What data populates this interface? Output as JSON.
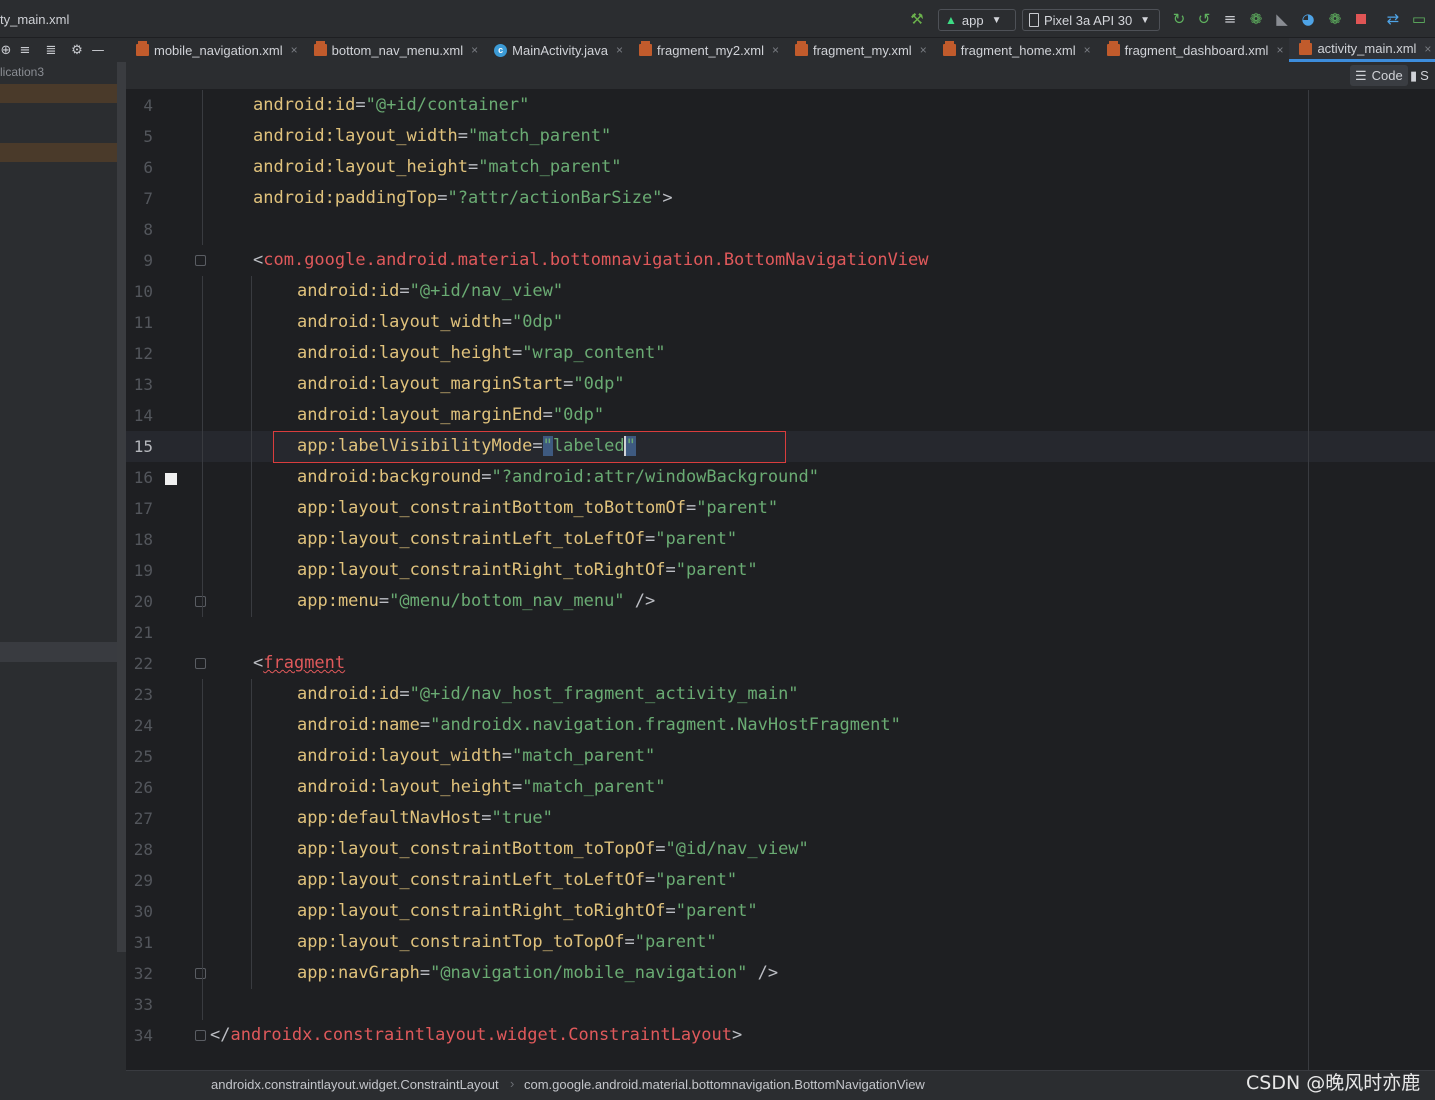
{
  "window": {
    "title": "ty_main.xml"
  },
  "toolbar": {
    "run_config": "app",
    "device": "Pixel 3a API 30",
    "icons": [
      "build-hammer-icon",
      "android-icon",
      "device-icon",
      "rerun-icon",
      "apply-changes-icon",
      "apply-code-changes-icon",
      "debug-icon",
      "attach-debugger-icon",
      "profile-icon",
      "coverage-icon",
      "stop-icon",
      "sync-gradle-icon",
      "device-manager-icon"
    ]
  },
  "left_panel": {
    "project_label": "lication3",
    "tools": [
      "target-icon",
      "expand-all-icon",
      "collapse-all-icon",
      "gear-icon",
      "minimize-icon"
    ]
  },
  "tabs": [
    {
      "label": "mobile_navigation.xml",
      "type": "xml",
      "active": false
    },
    {
      "label": "bottom_nav_menu.xml",
      "type": "xml",
      "active": false
    },
    {
      "label": "MainActivity.java",
      "type": "java",
      "active": false
    },
    {
      "label": "fragment_my2.xml",
      "type": "xml",
      "active": false
    },
    {
      "label": "fragment_my.xml",
      "type": "xml",
      "active": false
    },
    {
      "label": "fragment_home.xml",
      "type": "xml",
      "active": false
    },
    {
      "label": "fragment_dashboard.xml",
      "type": "xml",
      "active": false
    },
    {
      "label": "activity_main.xml",
      "type": "xml",
      "active": true
    }
  ],
  "view_mode": {
    "code_label": "Code",
    "split_label": "S"
  },
  "editor": {
    "current_line": "15",
    "lines": [
      {
        "n": "4",
        "indent": 1,
        "tokens": [
          [
            "attr",
            "android:id"
          ],
          [
            "punc",
            "="
          ],
          [
            "val",
            "\"@+id/container\""
          ]
        ]
      },
      {
        "n": "5",
        "indent": 1,
        "tokens": [
          [
            "attr",
            "android:layout_width"
          ],
          [
            "punc",
            "="
          ],
          [
            "val",
            "\"match_parent\""
          ]
        ]
      },
      {
        "n": "6",
        "indent": 1,
        "tokens": [
          [
            "attr",
            "android:layout_height"
          ],
          [
            "punc",
            "="
          ],
          [
            "val",
            "\"match_parent\""
          ]
        ]
      },
      {
        "n": "7",
        "indent": 1,
        "tokens": [
          [
            "attr",
            "android:paddingTop"
          ],
          [
            "punc",
            "="
          ],
          [
            "val",
            "\"?attr/actionBarSize\""
          ],
          [
            "punc",
            ">"
          ]
        ]
      },
      {
        "n": "8",
        "indent": 0,
        "tokens": []
      },
      {
        "n": "9",
        "indent": 1,
        "tokens": [
          [
            "punc",
            "<"
          ],
          [
            "tag",
            "com.google.android.material.bottomnavigation.BottomNavigationView"
          ]
        ]
      },
      {
        "n": "10",
        "indent": 2,
        "tokens": [
          [
            "attr",
            "android:id"
          ],
          [
            "punc",
            "="
          ],
          [
            "val",
            "\"@+id/nav_view\""
          ]
        ]
      },
      {
        "n": "11",
        "indent": 2,
        "tokens": [
          [
            "attr",
            "android:layout_width"
          ],
          [
            "punc",
            "="
          ],
          [
            "val",
            "\"0dp\""
          ]
        ]
      },
      {
        "n": "12",
        "indent": 2,
        "tokens": [
          [
            "attr",
            "android:layout_height"
          ],
          [
            "punc",
            "="
          ],
          [
            "val",
            "\"wrap_content\""
          ]
        ]
      },
      {
        "n": "13",
        "indent": 2,
        "tokens": [
          [
            "attr",
            "android:layout_marginStart"
          ],
          [
            "punc",
            "="
          ],
          [
            "val",
            "\"0dp\""
          ]
        ]
      },
      {
        "n": "14",
        "indent": 2,
        "tokens": [
          [
            "attr",
            "android:layout_marginEnd"
          ],
          [
            "punc",
            "="
          ],
          [
            "val",
            "\"0dp\""
          ]
        ]
      },
      {
        "n": "15",
        "indent": 2,
        "tokens": [
          [
            "attr",
            "app:labelVisibilityMode"
          ],
          [
            "punc",
            "="
          ],
          [
            "sel",
            "\""
          ],
          [
            "val",
            "labeled"
          ],
          [
            "selcaret",
            "\""
          ]
        ]
      },
      {
        "n": "16",
        "indent": 2,
        "tokens": [
          [
            "attr",
            "android:background"
          ],
          [
            "punc",
            "="
          ],
          [
            "val",
            "\"?android:attr/windowBackground\""
          ]
        ]
      },
      {
        "n": "17",
        "indent": 2,
        "tokens": [
          [
            "attr",
            "app:layout_constraintBottom_toBottomOf"
          ],
          [
            "punc",
            "="
          ],
          [
            "val",
            "\"parent\""
          ]
        ]
      },
      {
        "n": "18",
        "indent": 2,
        "tokens": [
          [
            "attr",
            "app:layout_constraintLeft_toLeftOf"
          ],
          [
            "punc",
            "="
          ],
          [
            "val",
            "\"parent\""
          ]
        ]
      },
      {
        "n": "19",
        "indent": 2,
        "tokens": [
          [
            "attr",
            "app:layout_constraintRight_toRightOf"
          ],
          [
            "punc",
            "="
          ],
          [
            "val",
            "\"parent\""
          ]
        ]
      },
      {
        "n": "20",
        "indent": 2,
        "tokens": [
          [
            "attr",
            "app:menu"
          ],
          [
            "punc",
            "="
          ],
          [
            "val",
            "\"@menu/bottom_nav_menu\""
          ],
          [
            "punc",
            " />"
          ]
        ]
      },
      {
        "n": "21",
        "indent": 0,
        "tokens": []
      },
      {
        "n": "22",
        "indent": 1,
        "tokens": [
          [
            "punc",
            "<"
          ],
          [
            "tagsq",
            "fragment"
          ]
        ]
      },
      {
        "n": "23",
        "indent": 2,
        "tokens": [
          [
            "attr",
            "android:id"
          ],
          [
            "punc",
            "="
          ],
          [
            "val",
            "\"@+id/nav_host_fragment_activity_main\""
          ]
        ]
      },
      {
        "n": "24",
        "indent": 2,
        "tokens": [
          [
            "attr",
            "android:name"
          ],
          [
            "punc",
            "="
          ],
          [
            "val",
            "\"androidx.navigation.fragment.NavHostFragment\""
          ]
        ]
      },
      {
        "n": "25",
        "indent": 2,
        "tokens": [
          [
            "attr",
            "android:layout_width"
          ],
          [
            "punc",
            "="
          ],
          [
            "val",
            "\"match_parent\""
          ]
        ]
      },
      {
        "n": "26",
        "indent": 2,
        "tokens": [
          [
            "attr",
            "android:layout_height"
          ],
          [
            "punc",
            "="
          ],
          [
            "val",
            "\"match_parent\""
          ]
        ]
      },
      {
        "n": "27",
        "indent": 2,
        "tokens": [
          [
            "attr",
            "app:defaultNavHost"
          ],
          [
            "punc",
            "="
          ],
          [
            "val",
            "\"true\""
          ]
        ]
      },
      {
        "n": "28",
        "indent": 2,
        "tokens": [
          [
            "attr",
            "app:layout_constraintBottom_toTopOf"
          ],
          [
            "punc",
            "="
          ],
          [
            "val",
            "\"@id/nav_view\""
          ]
        ]
      },
      {
        "n": "29",
        "indent": 2,
        "tokens": [
          [
            "attr",
            "app:layout_constraintLeft_toLeftOf"
          ],
          [
            "punc",
            "="
          ],
          [
            "val",
            "\"parent\""
          ]
        ]
      },
      {
        "n": "30",
        "indent": 2,
        "tokens": [
          [
            "attr",
            "app:layout_constraintRight_toRightOf"
          ],
          [
            "punc",
            "="
          ],
          [
            "val",
            "\"parent\""
          ]
        ]
      },
      {
        "n": "31",
        "indent": 2,
        "tokens": [
          [
            "attr",
            "app:layout_constraintTop_toTopOf"
          ],
          [
            "punc",
            "="
          ],
          [
            "val",
            "\"parent\""
          ]
        ]
      },
      {
        "n": "32",
        "indent": 2,
        "tokens": [
          [
            "attr",
            "app:navGraph"
          ],
          [
            "punc",
            "="
          ],
          [
            "val",
            "\"@navigation/mobile_navigation\""
          ],
          [
            "punc",
            " />"
          ]
        ]
      },
      {
        "n": "33",
        "indent": 0,
        "tokens": []
      },
      {
        "n": "34",
        "indent": 0,
        "tokens": [
          [
            "punc",
            "</"
          ],
          [
            "tag",
            "androidx.constraintlayout.widget.ConstraintLayout"
          ],
          [
            "punc",
            ">"
          ]
        ]
      }
    ]
  },
  "breadcrumb": {
    "items": [
      "androidx.constraintlayout.widget.ConstraintLayout",
      "com.google.android.material.bottomnavigation.BottomNavigationView"
    ],
    "separator": "›"
  },
  "watermark": "CSDN @晚风时亦鹿",
  "colors": {
    "attr": "#e0c27c",
    "tag": "#e0595b",
    "value": "#6aab73",
    "highlight_box": "#d93d3d",
    "active_tab": "#3d8ddc"
  }
}
